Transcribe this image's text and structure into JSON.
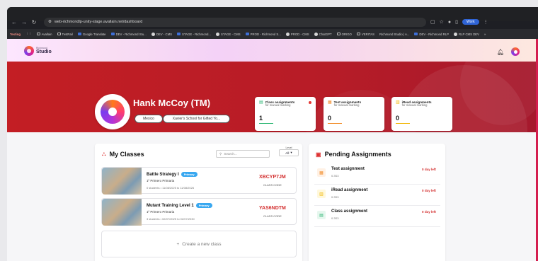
{
  "browser": {
    "url": "web-richmondlp-unity-stage.avallain.net/dashboard",
    "profile_label": "Work",
    "bookmarks": [
      "Testing",
      "Avallain",
      "TestRail",
      "Google Translate",
      "DEV - Richmond Stu...",
      "DEV - CMS",
      "STAGE - Richmond...",
      "STAGE - CMS",
      "PROD - Richmond S...",
      "PROD - CMS",
      "ChatGPT",
      "ORIGO",
      "VERITAS",
      "Richmond Studio | A...",
      "DEV - Richmond RLP",
      "RLP CMS DEV"
    ],
    "more": "»"
  },
  "app": {
    "logo_small": "Richmond",
    "logo_big": "Studio"
  },
  "profile": {
    "name": "Hank McCoy (TM)",
    "country": "Mexico",
    "school": "Xavier's School for Gifted Yo..."
  },
  "stats": [
    {
      "title": "Class assignments",
      "sub": "for manual marking",
      "value": "1",
      "color": "#2bb673",
      "icon": "document-icon"
    },
    {
      "title": "Test assignments",
      "sub": "for manual marking",
      "value": "0",
      "color": "#f28c28",
      "icon": "test-icon"
    },
    {
      "title": "iRead assignments",
      "sub": "for manual marking",
      "value": "0",
      "color": "#f2b705",
      "icon": "book-icon"
    }
  ],
  "classes": {
    "title": "My Classes",
    "search_placeholder": "Search...",
    "level_label": "Level",
    "level_value": "All",
    "items": [
      {
        "name": "Battle Strategy I",
        "badge": "Primary",
        "sub": "1º Primero Primaria",
        "meta": "0 students • 11/08/2025 to 11/08/2026",
        "code": "XBCYP7JM",
        "code_label": "CLASS CODE"
      },
      {
        "name": "Mutant Training Level 1",
        "badge": "Primary",
        "sub": "1º Primero Primaria",
        "meta": "3 students • 02/07/2025 to 02/07/2030",
        "code": "YAS6NDTM",
        "code_label": "CLASS CODE"
      }
    ],
    "create_label": "Create a new class"
  },
  "pending": {
    "title": "Pending Assignments",
    "items": [
      {
        "title": "Test assignment",
        "sub": "0.3S3",
        "due": "0 day left",
        "color": "#f28c28",
        "bg": "#fff1e5"
      },
      {
        "title": "iRead assignment",
        "sub": "0.3S3",
        "due": "0 day left",
        "color": "#f2b705",
        "bg": "#fff8dc"
      },
      {
        "title": "Class assignment",
        "sub": "0.3S3",
        "due": "0 day left",
        "color": "#2bb673",
        "bg": "#e6f7ee"
      }
    ]
  }
}
